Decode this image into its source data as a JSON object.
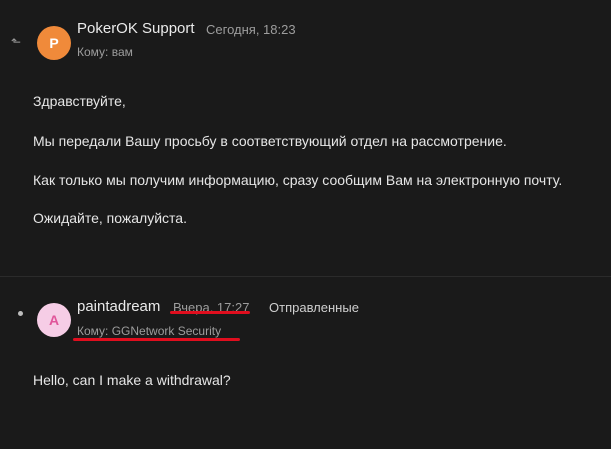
{
  "messages": [
    {
      "avatar_letter": "P",
      "avatar_color": "#f08a3a",
      "status_icon": "reply-arrow-icon",
      "sender": "PokerOK Support",
      "date": "Сегодня, 18:23",
      "recipient": "Кому: вам",
      "body": [
        "Здравствуйте,",
        "Мы передали Вашу просьбу в соответствующий отдел на рассмотрение.",
        "Как только мы получим информацию, сразу сообщим Вам на электронную почту.",
        "Ожидайте, пожалуйста."
      ]
    },
    {
      "avatar_letter": "A",
      "avatar_color": "#f6cde6",
      "status_icon": "unread-dot-icon",
      "sender": "paintadream",
      "date": "Вчера, 17:27",
      "folder": "Отправленные",
      "recipient": "Кому: GGNetwork Security",
      "body": [
        "Hello, can I make a withdrawal?"
      ],
      "highlight_color": "#e00e1e"
    }
  ]
}
